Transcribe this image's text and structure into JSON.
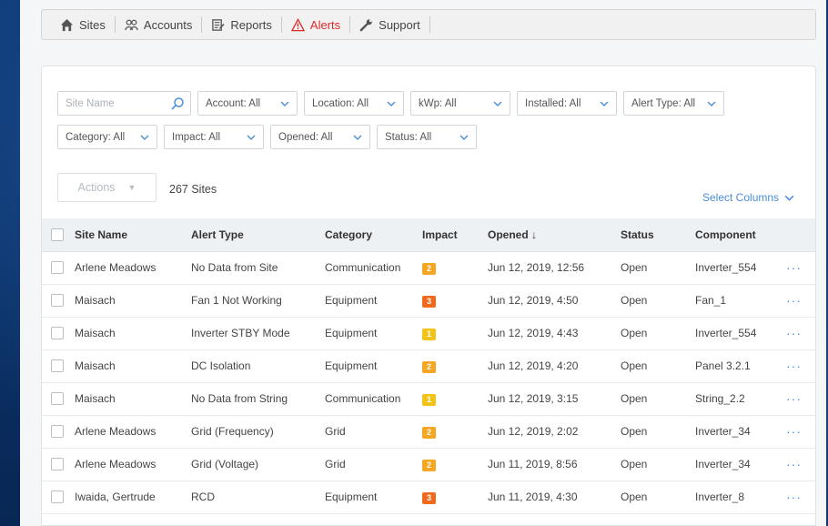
{
  "nav": {
    "items": [
      {
        "label": "Sites",
        "icon": "home-icon",
        "active": false
      },
      {
        "label": "Accounts",
        "icon": "accounts-icon",
        "active": false
      },
      {
        "label": "Reports",
        "icon": "reports-icon",
        "active": false
      },
      {
        "label": "Alerts",
        "icon": "alert-triangle-icon",
        "active": true
      },
      {
        "label": "Support",
        "icon": "wrench-icon",
        "active": false
      }
    ]
  },
  "filters": {
    "search_placeholder": "Site Name",
    "row1": [
      "Account: All",
      "Location: All",
      "kWp: All",
      "Installed: All",
      "Alert Type: All"
    ],
    "row2": [
      "Category: All",
      "Impact: All",
      "Opened: All",
      "Status: All"
    ]
  },
  "toolbar": {
    "actions_label": "Actions",
    "count_label": "267 Sites",
    "select_columns_label": "Select Columns"
  },
  "table": {
    "columns": [
      "Site Name",
      "Alert Type",
      "Category",
      "Impact",
      "Opened ↓",
      "Status",
      "Component"
    ],
    "rows": [
      {
        "site": "Arlene Meadows",
        "alert": "No Data from Site",
        "category": "Communication",
        "impact": "2",
        "opened": "Jun 12, 2019, 12:56",
        "status": "Open",
        "component": "Inverter_554"
      },
      {
        "site": "Maisach",
        "alert": "Fan 1 Not Working",
        "category": "Equipment",
        "impact": "3",
        "opened": "Jun 12, 2019, 4:50",
        "status": "Open",
        "component": "Fan_1"
      },
      {
        "site": "Maisach",
        "alert": "Inverter STBY Mode",
        "category": "Equipment",
        "impact": "1",
        "opened": "Jun 12, 2019, 4:43",
        "status": "Open",
        "component": "Inverter_554"
      },
      {
        "site": "Maisach",
        "alert": "DC Isolation",
        "category": "Equipment",
        "impact": "2",
        "opened": "Jun 12, 2019, 4:20",
        "status": "Open",
        "component": "Panel 3.2.1"
      },
      {
        "site": "Maisach",
        "alert": "No Data from String",
        "category": "Communication",
        "impact": "1",
        "opened": "Jun 12, 2019, 3:15",
        "status": "Open",
        "component": "String_2.2"
      },
      {
        "site": "Arlene Meadows",
        "alert": "Grid (Frequency)",
        "category": "Grid",
        "impact": "2",
        "opened": "Jun 12, 2019, 2:02",
        "status": "Open",
        "component": "Inverter_34"
      },
      {
        "site": "Arlene Meadows",
        "alert": "Grid (Voltage)",
        "category": "Grid",
        "impact": "2",
        "opened": "Jun 11, 2019, 8:56",
        "status": "Open",
        "component": "Inverter_34"
      },
      {
        "site": "Iwaida, Gertrude",
        "alert": "RCD",
        "category": "Equipment",
        "impact": "3",
        "opened": "Jun 11, 2019, 4:30",
        "status": "Open",
        "component": "Inverter_8"
      }
    ]
  },
  "colors": {
    "impact_1": "#f2c318",
    "impact_2": "#f5a623",
    "impact_3": "#f06a1c",
    "accent": "#4a8fd8",
    "alert_red": "#e02a2a"
  }
}
